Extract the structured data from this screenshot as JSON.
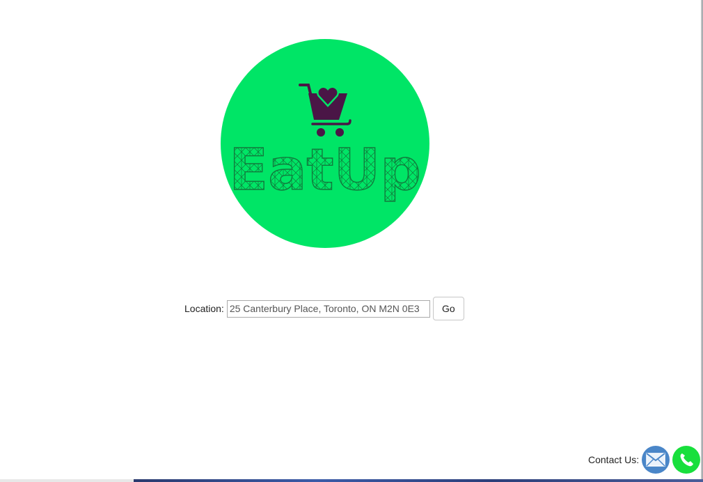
{
  "logo": {
    "brand_text": "EatUp",
    "circle_color": "#00e566",
    "icon": "shopping-cart-heart-icon",
    "icon_color": "#4a1646"
  },
  "location": {
    "label": "Location:",
    "value": "25 Canterbury Place, Toronto, ON M2N 0E3",
    "go_label": "Go"
  },
  "contact": {
    "label": "Contact Us:",
    "email_icon": "email-icon",
    "email_color": "#4a86c8",
    "phone_icon": "phone-icon",
    "phone_color": "#18df3c"
  }
}
